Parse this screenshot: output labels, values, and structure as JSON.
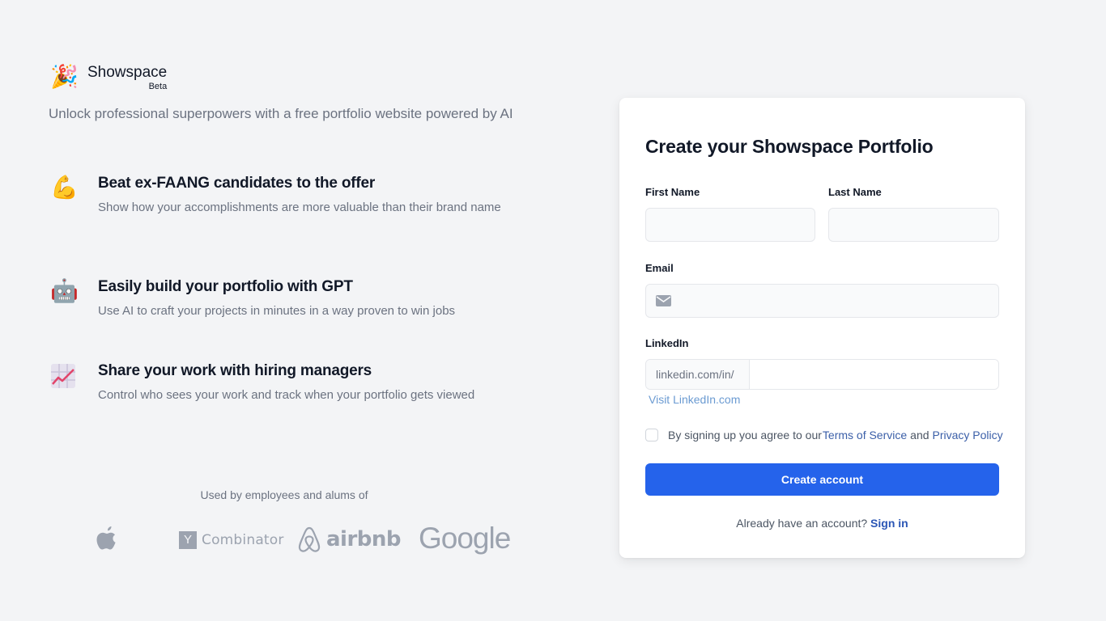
{
  "brand": {
    "name": "Showspace",
    "badge": "Beta",
    "logo_icon": "party-popper-icon",
    "tagline": "Unlock professional superpowers with a free portfolio website powered by AI"
  },
  "features": [
    {
      "icon": "flexed-biceps-icon",
      "title": "Beat ex-FAANG candidates to the offer",
      "description": "Show how your accomplishments are more valuable than their brand name"
    },
    {
      "icon": "robot-icon",
      "title": "Easily build your portfolio with GPT",
      "description": "Use AI to craft your projects in minutes in a way proven to win jobs"
    },
    {
      "icon": "chart-increasing-icon",
      "title": "Share your work with hiring managers",
      "description": "Control who sees your work and track when your portfolio gets viewed"
    }
  ],
  "social_proof": {
    "heading": "Used by employees and alums of",
    "logos": [
      {
        "name": "Apple",
        "icon": "apple-logo-icon"
      },
      {
        "name": "Y Combinator",
        "box": "Y",
        "text": "Combinator"
      },
      {
        "name": "Airbnb",
        "text": "airbnb"
      },
      {
        "name": "Google",
        "text": "Google"
      }
    ]
  },
  "signup": {
    "title": "Create your Showspace Portfolio",
    "first_name": {
      "label": "First Name",
      "value": "",
      "placeholder": ""
    },
    "last_name": {
      "label": "Last Name",
      "value": "",
      "placeholder": ""
    },
    "email": {
      "label": "Email",
      "value": "",
      "placeholder": "",
      "icon": "envelope-icon"
    },
    "linkedin": {
      "label": "LinkedIn",
      "prefix": "linkedin.com/in/",
      "value": "",
      "placeholder": "",
      "visit_link": "Visit LinkedIn.com"
    },
    "terms": {
      "checked": false,
      "text": "By signing up you agree to our",
      "terms_link": "Terms of Service",
      "and": "and",
      "privacy_link": "Privacy Policy"
    },
    "submit_label": "Create account",
    "signin_prompt": "Already have an account?",
    "signin_link": "Sign in"
  },
  "colors": {
    "background": "#f3f4f6",
    "primary": "#2563eb",
    "link": "#3b5fa8",
    "muted_text": "#6b7280"
  }
}
